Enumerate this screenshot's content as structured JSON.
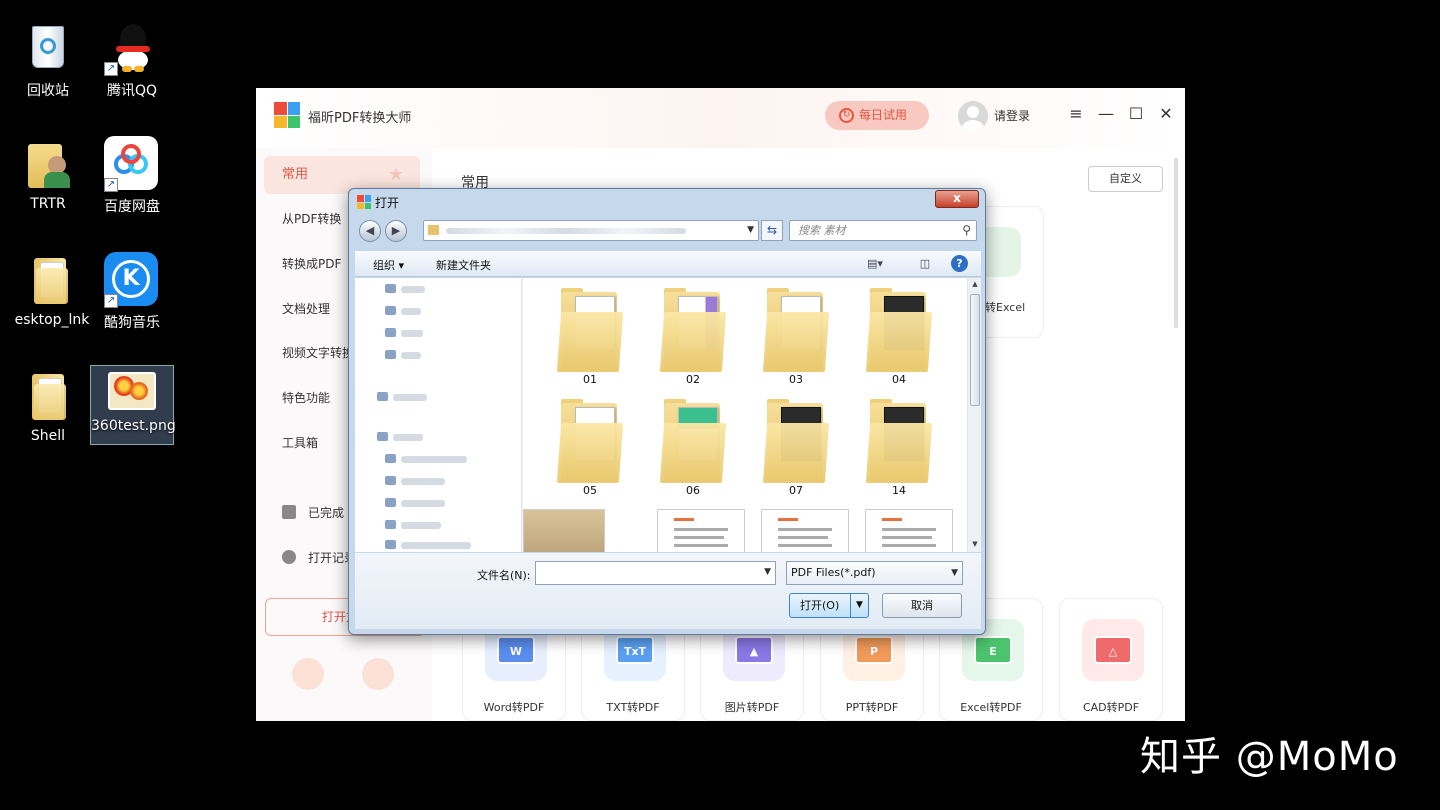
{
  "desktop": {
    "icons": [
      {
        "label": "回收站",
        "icon": "recycle-bin-icon"
      },
      {
        "label": "腾讯QQ",
        "icon": "qq-penguin-icon"
      },
      {
        "label": "TRTR",
        "icon": "user-folder-icon"
      },
      {
        "label": "百度网盘",
        "icon": "baidu-cloud-icon"
      },
      {
        "label": "esktop_lnk",
        "icon": "folder-icon"
      },
      {
        "label": "酷狗音乐",
        "icon": "kugou-icon"
      },
      {
        "label": "Shell",
        "icon": "folder-icon"
      },
      {
        "label": "360test.png",
        "icon": "image-file-icon"
      }
    ]
  },
  "app": {
    "title": "福昕PDF转换大师",
    "trial_label": "每日试用",
    "login_label": "请登录",
    "window_controls": [
      "≡",
      "—",
      "☐",
      "✕"
    ],
    "sidebar": {
      "items": [
        "常用",
        "从PDF转换",
        "转换成PDF",
        "文档处理",
        "视频文字转换",
        "特色功能",
        "工具箱"
      ],
      "completed_label": "已完成",
      "records_label": "打开记录",
      "open_button_label": "打开文件"
    },
    "main": {
      "section_title": "常用",
      "customize_label": "自定义",
      "top_right_card_label": "转Excel",
      "cards": [
        {
          "label": "Word转PDF",
          "glyph": "W",
          "color": "#5b8def",
          "bg": "#e7efff"
        },
        {
          "label": "TXT转PDF",
          "glyph": "TxT",
          "color": "#5aa0f0",
          "bg": "#e5f1ff"
        },
        {
          "label": "图片转PDF",
          "glyph": "▲",
          "color": "#8a78e6",
          "bg": "#efebff"
        },
        {
          "label": "PPT转PDF",
          "glyph": "P",
          "color": "#f29a5a",
          "bg": "#fff0e4"
        },
        {
          "label": "Excel转PDF",
          "glyph": "E",
          "color": "#4cc46e",
          "bg": "#e4f7ea"
        },
        {
          "label": "CAD转PDF",
          "glyph": "△",
          "color": "#ef6b6b",
          "bg": "#ffe9e9"
        }
      ]
    }
  },
  "dialog": {
    "title": "打开",
    "close_label": "x",
    "search_placeholder": "搜索 素材",
    "toolbar": {
      "organize": "组织 ▾",
      "new_folder": "新建文件夹"
    },
    "folders": [
      {
        "name": "01",
        "doc": "plain"
      },
      {
        "name": "02",
        "doc": "prp"
      },
      {
        "name": "03",
        "doc": "plain"
      },
      {
        "name": "04",
        "doc": "dark"
      },
      {
        "name": "05",
        "doc": "plain"
      },
      {
        "name": "06",
        "doc": "grn"
      },
      {
        "name": "07",
        "doc": "dark"
      },
      {
        "name": "14",
        "doc": "dark"
      }
    ],
    "filename_label": "文件名(N):",
    "filename_value": "",
    "filetype_value": "PDF Files(*.pdf)",
    "open_button": "打开(O)",
    "cancel_button": "取消"
  },
  "watermark": "知乎 @MoMo"
}
